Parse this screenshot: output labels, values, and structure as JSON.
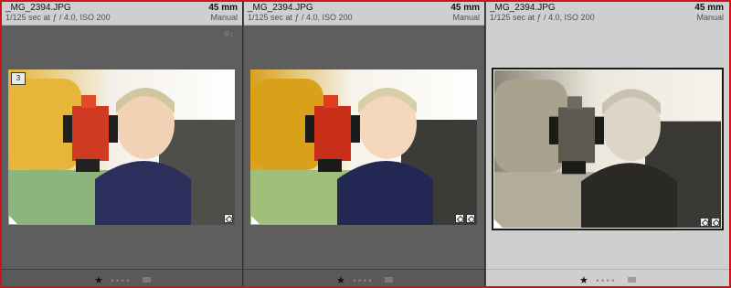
{
  "panels": [
    {
      "filename": "_MG_2394.JPG",
      "exposure": "1/125 sec at ƒ / 4.0, ISO 200",
      "focal_length": "45 mm",
      "mode": "Manual",
      "index_badge": "3",
      "rating_star": "★",
      "rating_dots": "• • • •",
      "style": "color"
    },
    {
      "filename": "_MG_2394.JPG",
      "exposure": "1/125 sec at ƒ / 4.0, ISO 200",
      "focal_length": "45 mm",
      "mode": "Manual",
      "rating_star": "★",
      "rating_dots": "• • • •",
      "style": "color-bright"
    },
    {
      "filename": "_MG_2394.JPG",
      "exposure": "1/125 sec at ƒ / 4.0, ISO 200",
      "focal_length": "45 mm",
      "mode": "Manual",
      "rating_star": "★",
      "rating_dots": "• • • •",
      "style": "sepia"
    }
  ],
  "icons": {
    "sort": "sort-icon",
    "develop_badge": "develop-settings-icon",
    "crop_badge": "crop-icon",
    "flag": "flag-icon"
  },
  "colors": {
    "frame_border": "#c8161d",
    "panel_dark": "#5e5e5e",
    "panel_selected": "#cfcfcf"
  }
}
